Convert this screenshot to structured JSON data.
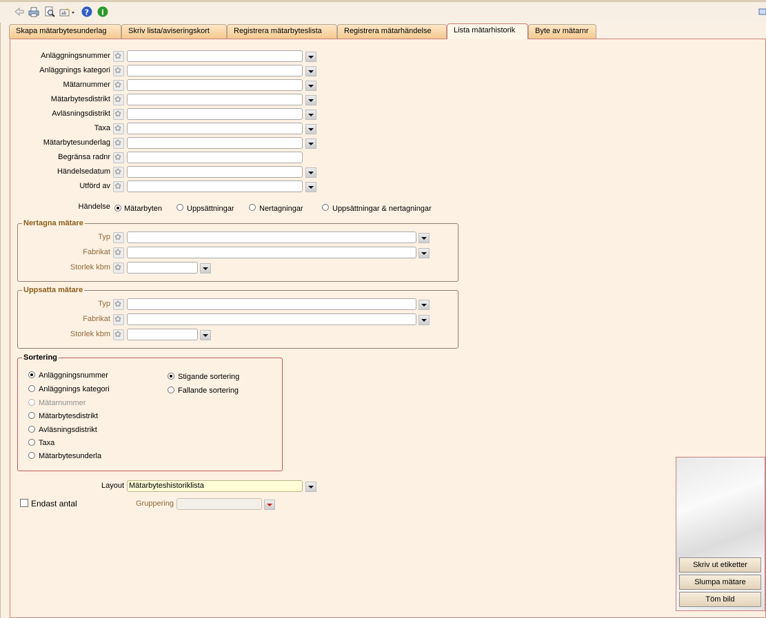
{
  "tabs": [
    "Skapa mätarbytesunderlag",
    "Skriv lista/aviseringskort",
    "Registrera mätarbyteslista",
    "Registrera mätarhändelse",
    "Lista mätarhistorik",
    "Byte av mätarnr"
  ],
  "active_tab": "Lista mätarhistorik",
  "filters": {
    "anlaggningsnummer": "Anläggningsnummer",
    "anlaggnings_kategori": "Anläggnings kategori",
    "matarnummer": "Mätarnummer",
    "matarbytesdistrikt": "Mätarbytesdistrikt",
    "avlasningsdistrikt": "Avläsningsdistrikt",
    "taxa": "Taxa",
    "matarbytesunderlag": "Mätarbytesunderlag",
    "begransa_radnr": "Begränsa radnr",
    "handelsedatum": "Händelsedatum",
    "utford_av": "Utförd av"
  },
  "handelse": {
    "label": "Händelse",
    "options": [
      "Mätarbyten",
      "Uppsättningar",
      "Nertagningar",
      "Uppsättningar & nertagningar"
    ],
    "selected": "Mätarbyten"
  },
  "nertagna": {
    "title": "Nertagna mätare",
    "typ": "Typ",
    "fabrikat": "Fabrikat",
    "storlek": "Storlek kbm"
  },
  "uppsatta": {
    "title": "Uppsatta mätare",
    "typ": "Typ",
    "fabrikat": "Fabrikat",
    "storlek": "Storlek kbm"
  },
  "sortering": {
    "title": "Sortering",
    "fields": [
      "Anläggningsnummer",
      "Anläggnings kategori",
      "Mätarnummer",
      "Mätarbytesdistrikt",
      "Avläsningsdistrikt",
      "Taxa",
      "Mätarbytesunderla"
    ],
    "selected_field": "Anläggningsnummer",
    "order": [
      "Stigande sortering",
      "Fallande sortering"
    ],
    "selected_order": "Stigande sortering"
  },
  "layout": {
    "label": "Layout",
    "value": "Mätarbyteshistoriklista"
  },
  "endast_antal": {
    "label": "Endast antal",
    "checked": false
  },
  "gruppering": {
    "label": "Gruppering",
    "value": ""
  },
  "side_buttons": {
    "skriv": "Skriv ut etiketter",
    "slumpa": "Slumpa mätare",
    "tom": "Töm bild"
  },
  "colors": {
    "panel_border": "#cc7f7f",
    "tab_gradient": "#f5c98e",
    "group_label": "#8a5f18"
  }
}
